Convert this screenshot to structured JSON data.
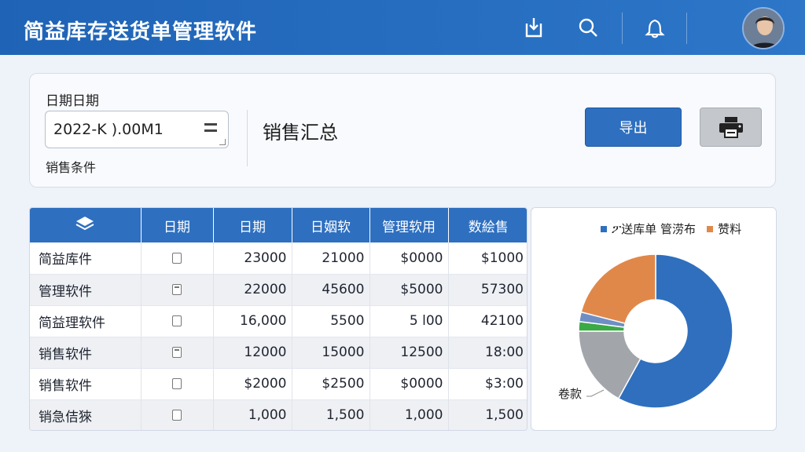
{
  "header": {
    "title": "简益库存送货单管理软件"
  },
  "filter": {
    "date_label": "日期日期",
    "date_value": "2022-K ).00M1",
    "condition_label": "销售条件",
    "summary_title": "销售汇总",
    "export_label": "导出"
  },
  "table": {
    "headers": [
      "日期",
      "日期",
      "日姻软",
      "管理软用",
      "数絵售"
    ],
    "rows": [
      {
        "name": "简益库件",
        "c1": "23000",
        "c2": "21000",
        "c3": "$0000",
        "c4": "$1000",
        "doc": false
      },
      {
        "name": "管理软件",
        "c1": "22000",
        "c2": "45600",
        "c3": "$5000",
        "c4": "57300",
        "doc": true
      },
      {
        "name": "简益理软件",
        "c1": "16,000",
        "c2": "5500",
        "c3": "5 l00",
        "c4": "42100",
        "doc": false
      },
      {
        "name": "销售软件",
        "c1": "12000",
        "c2": "15000",
        "c3": "12500",
        "c4": "18:00",
        "doc": true
      },
      {
        "name": "销售软件",
        "c1": "$2000",
        "c2": "$2500",
        "c3": "$0000",
        "c4": "$3:00",
        "doc": false
      },
      {
        "name": "销急佶猍",
        "c1": "1,000",
        "c2": "1,500",
        "c3": "1,000",
        "c4": "1,500",
        "doc": false
      }
    ]
  },
  "chart_data": {
    "type": "pie",
    "legend": [
      {
        "label": "ፖ送库单 管涝布",
        "color": "#2f6fbe"
      },
      {
        "label": "赞料",
        "color": "#e0884a"
      }
    ],
    "annotation": "卷款",
    "slices": [
      {
        "value": 58,
        "color": "#2f6fbe"
      },
      {
        "value": 17,
        "color": "#a2a6ab"
      },
      {
        "value": 2,
        "color": "#3aaa45"
      },
      {
        "value": 2,
        "color": "#6f8fc4"
      },
      {
        "value": 21,
        "color": "#e0884a"
      }
    ]
  },
  "colors": {
    "header": "#2d76c8",
    "accent": "#2e6fc0"
  }
}
